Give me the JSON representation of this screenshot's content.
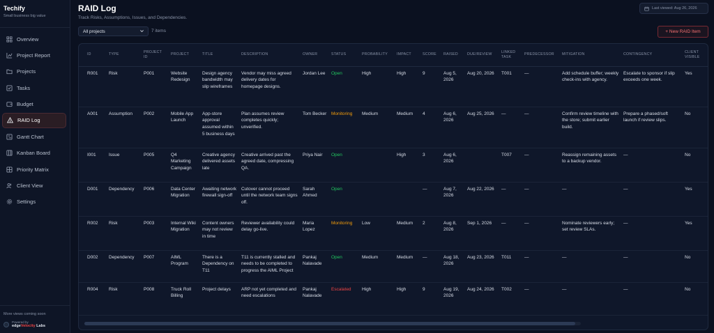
{
  "app": {
    "name": "Techify",
    "tagline": "Small business big value"
  },
  "sidebar": {
    "items": [
      {
        "label": "Overview",
        "icon": "grid-icon"
      },
      {
        "label": "Project Report",
        "icon": "chart-icon"
      },
      {
        "label": "Projects",
        "icon": "folder-icon"
      },
      {
        "label": "Tasks",
        "icon": "checkbox-icon"
      },
      {
        "label": "Budget",
        "icon": "wallet-icon"
      },
      {
        "label": "RAID Log",
        "icon": "warning-icon",
        "active": true
      },
      {
        "label": "Gantt Chart",
        "icon": "gantt-icon"
      },
      {
        "label": "Kanban Board",
        "icon": "kanban-icon"
      },
      {
        "label": "Priority Matrix",
        "icon": "matrix-icon"
      },
      {
        "label": "Client View",
        "icon": "users-icon"
      },
      {
        "label": "Settings",
        "icon": "gear-icon"
      }
    ],
    "more_views": "More views coming soon",
    "powered_by": "Powered by",
    "powered_brand_a": "edge",
    "powered_brand_b": "Velocity",
    "powered_brand_c": " Labs"
  },
  "header": {
    "title": "RAID Log",
    "subtitle": "Track Risks, Assumptions, Issues, and Dependencies.",
    "last_viewed": "Last viewed: Aug 26, 2026"
  },
  "toolbar": {
    "filter_value": "All projects",
    "count": "7 items",
    "new_button": "+ New RAID Item"
  },
  "table": {
    "columns": [
      "ID",
      "Type",
      "Project ID",
      "Project",
      "Title",
      "Description",
      "Owner",
      "Status",
      "Probability",
      "Impact",
      "Score",
      "Raised",
      "Due/Review",
      "Linked Task",
      "Predecessor",
      "Mitigation",
      "Contingency",
      "Client Visible"
    ],
    "rows": [
      [
        "R001",
        "Risk",
        "P001",
        "Website Redesign",
        "Design agency bandwidth may slip wireframes",
        "Vendor may miss agreed delivery dates for homepage designs.",
        "Jordan Lee",
        "Open",
        "High",
        "High",
        "9",
        "Aug 5, 2026",
        "Aug 20, 2026",
        "T001",
        "—",
        "Add schedule buffer; weekly check-ins with agency.",
        "Escalate to sponsor if slip exceeds one week.",
        "Yes"
      ],
      [
        "A001",
        "Assumption",
        "P002",
        "Mobile App Launch",
        "App-store approval assumed within 5 business days",
        "Plan assumes review completes quickly; unverified.",
        "Tom Becker",
        "Monitoring",
        "Medium",
        "Medium",
        "4",
        "Aug 6, 2026",
        "Aug 25, 2026",
        "—",
        "—",
        "Confirm review timeline with the store; submit earlier build.",
        "Prepare a phased/soft launch if review slips.",
        "No"
      ],
      [
        "I001",
        "Issue",
        "P005",
        "Q4 Marketing Campaign",
        "Creative agency delivered assets late",
        "Creative arrived past the agreed date, compressing QA.",
        "Priya Nair",
        "Open",
        "",
        "High",
        "3",
        "Aug 6, 2026",
        "",
        "T007",
        "—",
        "Reassign remaining assets to a backup vendor.",
        "—",
        "No"
      ],
      [
        "D001",
        "Dependency",
        "P006",
        "Data Center Migration",
        "Awaiting network firewall sign-off",
        "Cutover cannot proceed until the network team signs off.",
        "Sarah Ahmed",
        "Open",
        "",
        "",
        "—",
        "Aug 7, 2026",
        "Aug 22, 2026",
        "—",
        "—",
        "—",
        "—",
        "Yes"
      ],
      [
        "R002",
        "Risk",
        "P003",
        "Internal Wiki Migration",
        "Content owners may not review in time",
        "Reviewer availability could delay go-live.",
        "Maria Lopez",
        "Monitoring",
        "Low",
        "Medium",
        "2",
        "Aug 8, 2026",
        "Sep 1, 2026",
        "—",
        "—",
        "Nominate reviewers early; set review SLAs.",
        "—",
        "Yes"
      ],
      [
        "D002",
        "Dependency",
        "P007",
        "AIML Program",
        "There is a Dependency on T11",
        "T11 is currently stalled and needs to be completed to progress the AIML Project",
        "Pankaj Nalavade",
        "Open",
        "Medium",
        "Medium",
        "—",
        "Aug 18, 2026",
        "Aug 23, 2026",
        "T011",
        "—",
        "—",
        "—",
        "No"
      ],
      [
        "R004",
        "Risk",
        "P008",
        "Truck Roll Billing",
        "Project delays",
        "ARP not yet completed and need escalations",
        "Pankaj Nalavade",
        "Escalated",
        "High",
        "High",
        "9",
        "Aug 19, 2026",
        "Aug 24, 2026",
        "T002",
        "—",
        "—",
        "—",
        "No"
      ]
    ]
  },
  "colors": {
    "background": "#0b1120",
    "accent": "#ef4444",
    "open": "#22c55e",
    "monitoring": "#f59e0b",
    "escalated": "#ef4444"
  }
}
